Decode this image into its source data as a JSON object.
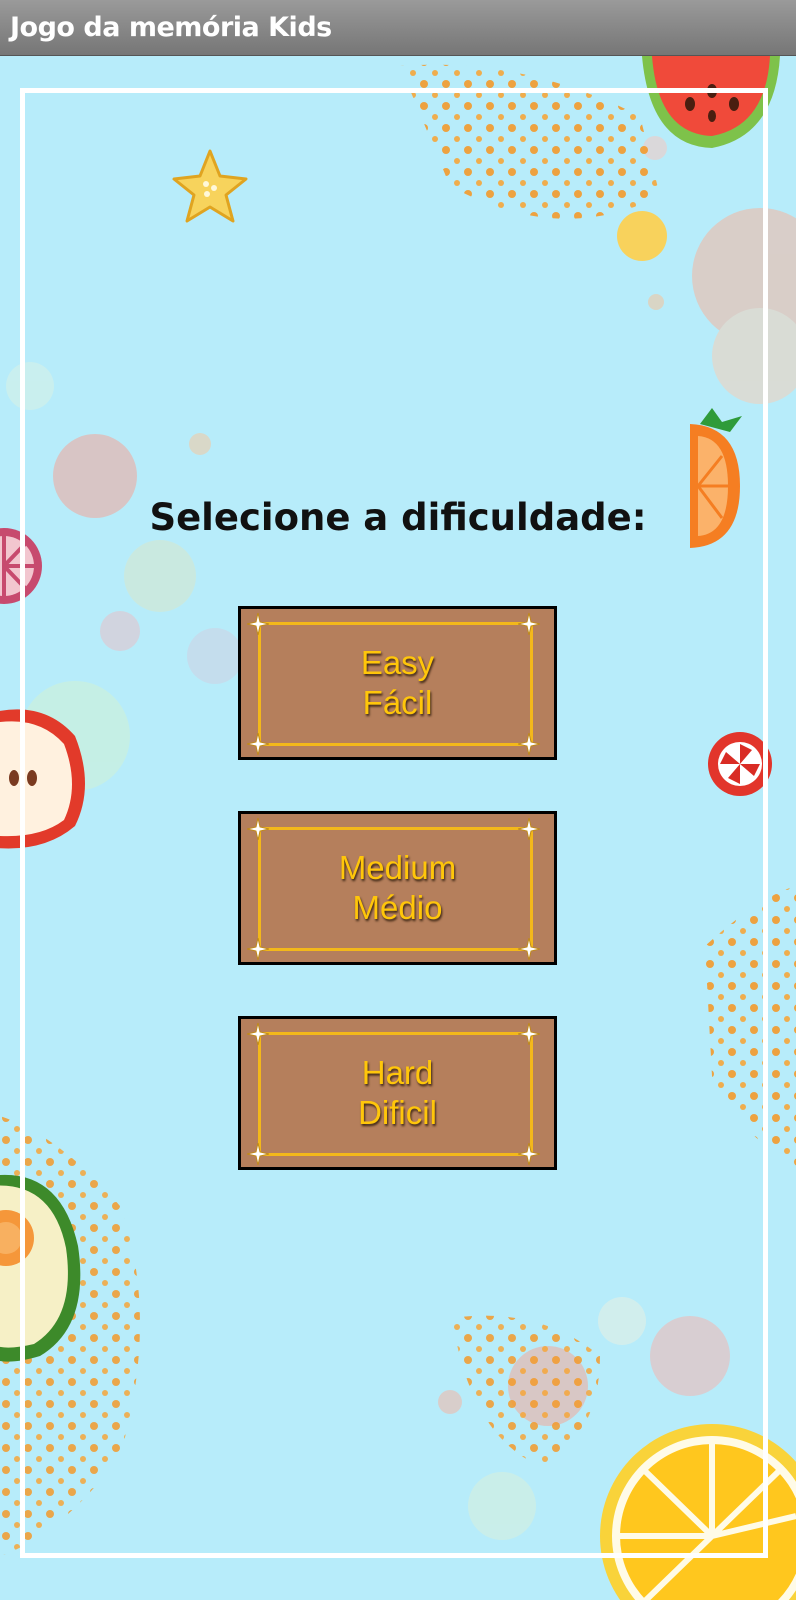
{
  "app": {
    "title": "Jogo da memória Kids"
  },
  "screen": {
    "heading": "Selecione a dificuldade:"
  },
  "difficulties": [
    {
      "line1": "Easy",
      "line2": "Fácil"
    },
    {
      "line1": "Medium",
      "line2": "Médio"
    },
    {
      "line1": "Hard",
      "line2": "Dificil"
    }
  ],
  "colors": {
    "background": "#b7ecfa",
    "button_fill": "#b57f5c",
    "button_border": "#000000",
    "button_inner_border": "#f3b81a",
    "button_text": "#ffc60a",
    "frame": "#ffffff"
  }
}
